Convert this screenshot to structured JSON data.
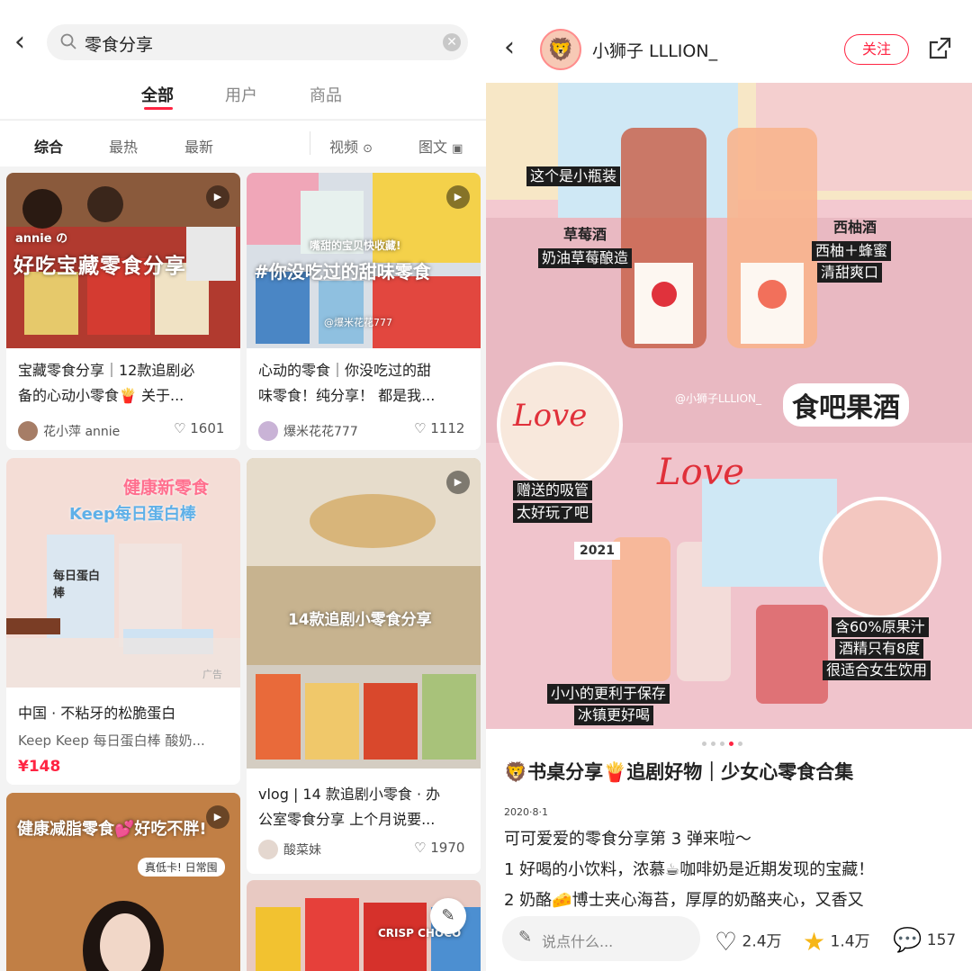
{
  "left": {
    "search": {
      "query": "零食分享"
    },
    "tabs": [
      "全部",
      "用户",
      "商品"
    ],
    "filters": {
      "sort": [
        "综合",
        "最热",
        "最新"
      ],
      "video": "视频",
      "image": "图文"
    },
    "cards": [
      {
        "title1": "宝藏零食分享｜12款追剧必",
        "title2": "备的心动小零食🍟 关于...",
        "user": "花小萍 annie",
        "likes": "1601",
        "overlay_small": "annie の",
        "overlay": "好吃宝藏零食分享"
      },
      {
        "title1": "心动的零食｜你没吃过的甜",
        "title2": "味零食！纯分享！ 都是我...",
        "user": "爆米花花777",
        "likes": "1112",
        "overlay_small": "嘴甜的宝贝快收藏!",
        "overlay": "#你没吃过的甜味零食",
        "watermark": "@爆米花花777"
      },
      {
        "title1": "中国 · 不粘牙的松脆蛋白",
        "subtitle": "Keep Keep 每日蛋白棒 酸奶...",
        "price": "¥148",
        "ad": "广告",
        "overlay": "健康新零食",
        "overlay2": "Keep每日蛋白棒",
        "pack": "每日蛋白棒"
      },
      {
        "title1": "vlog | 14 款追剧小零食 · 办",
        "title2": "公室零食分享 上个月说要...",
        "user": "酸菜妹",
        "likes": "1970",
        "overlay": "14款追剧小零食分享"
      },
      {
        "overlay": "健康减脂零食💕好吃不胖!",
        "badge": "真低卡! 日常囤"
      },
      {
        "overlay": "CRISP CHOCO"
      }
    ]
  },
  "right": {
    "author": "小狮子 LLLION_",
    "follow": "关注",
    "photo": {
      "labels": [
        "这个是小瓶装",
        "草莓酒",
        "奶油草莓酿造",
        "西柚酒",
        "西柚＋蜂蜜",
        "清甜爽口",
        "赠送的吸管",
        "太好玩了吧",
        "含60%原果汁",
        "酒精只有8度",
        "很适合女生饮用",
        "小小的更利于保存",
        "冰镇更好喝"
      ],
      "big": "食吧果酒",
      "watermark": "@小狮子LLLION_",
      "love": "Love",
      "year": "2021"
    },
    "post": {
      "title": "🦁书桌分享🍟追剧好物｜少女心零食合集",
      "date": "2020·8·1",
      "lines": [
        "可可爱爱的零食分享第 3 弹来啦～",
        "1 好喝的小饮料，浓慕☕咖啡奶是近期发现的宝藏！",
        "2 奶酪🧀博士夹心海苔，厚厚的奶酪夹心，又香又"
      ]
    },
    "bar": {
      "placeholder": "说点什么...",
      "likes": "2.4万",
      "stars": "1.4万",
      "comments": "157"
    }
  }
}
